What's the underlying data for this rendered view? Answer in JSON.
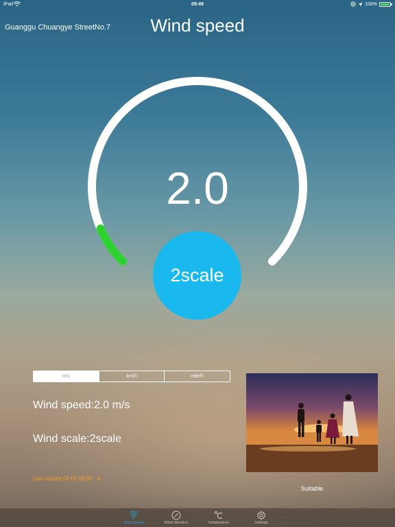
{
  "status_bar": {
    "carrier": "iPad",
    "time": "09:49",
    "battery": "100%",
    "battery_level": 1.0
  },
  "header": {
    "location": "Guanggu Chuangye StreetNo.7",
    "title": "Wind speed"
  },
  "gauge": {
    "value": "2.0",
    "scale_label": "2scale",
    "level_fraction": 0.08,
    "track_color": "#ffffff",
    "level_color": "#2ed22e"
  },
  "units": {
    "tabs": [
      {
        "label": "m/s",
        "active": true
      },
      {
        "label": "km/h"
      },
      {
        "label": "mile/h"
      }
    ]
  },
  "details": {
    "speed": "Wind speed:2.0 m/s",
    "scale": "Wind scale:2scale",
    "last_update": "Last update:02-05 09:00"
  },
  "activity": {
    "label": "Suitable"
  },
  "tab_bar": {
    "items": [
      {
        "label": "Wind speed",
        "icon": "wind-speed-icon",
        "active": true
      },
      {
        "label": "Wind direction",
        "icon": "compass-icon"
      },
      {
        "label": "temperature",
        "icon": "celsius-icon"
      },
      {
        "label": "Settings",
        "icon": "gear-icon"
      }
    ]
  },
  "colors": {
    "accent": "#19b9ef",
    "active_tab": "#2a9ad8",
    "update_text": "#f0a030"
  }
}
